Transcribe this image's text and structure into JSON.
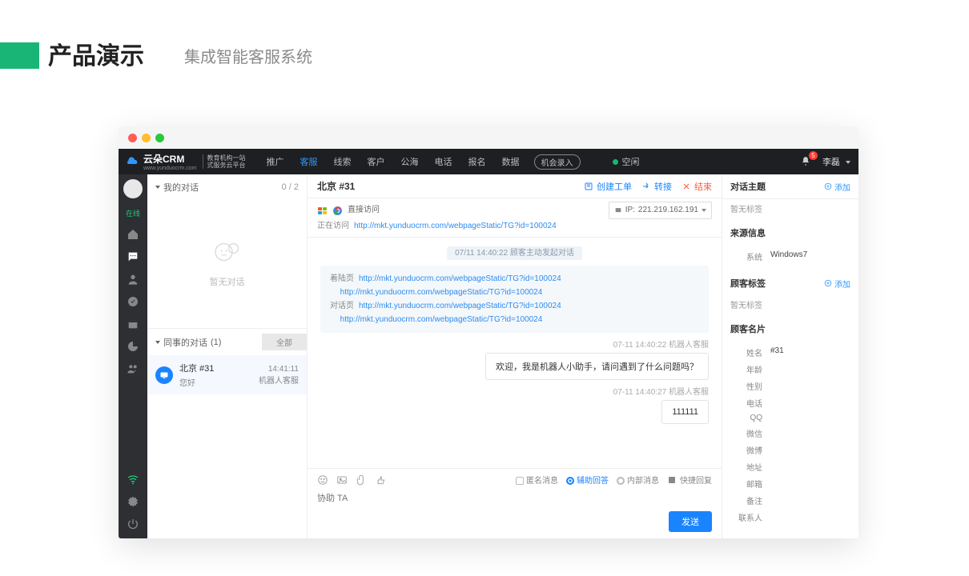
{
  "slide": {
    "title": "产品演示",
    "subtitle": "集成智能客服系统",
    "accent_color": "#19b576"
  },
  "window": {
    "traffic_colors": [
      "#ff5f56",
      "#ffbd2e",
      "#27c93f"
    ]
  },
  "nav": {
    "brand": "云朵CRM",
    "brand_sub_url": "www.yunduocrm.com",
    "tagline1": "教育机构一站",
    "tagline2": "式服务云平台",
    "tabs": [
      "推广",
      "客服",
      "线索",
      "客户",
      "公海",
      "电话",
      "报名",
      "数据"
    ],
    "active_tab_index": 1,
    "record_btn": "机会录入",
    "status_dot": "#19b576",
    "status_text": "空闲",
    "bell_count": "5",
    "user_name": "李磊"
  },
  "rail": {
    "status": "在线"
  },
  "conversations": {
    "mine_label": "我的对话",
    "mine_count": "0 / 2",
    "empty_text": "暂无对话",
    "colleague_label": "同事的对话",
    "colleague_count": "(1)",
    "all_btn": "全部",
    "item": {
      "title": "北京 #31",
      "snippet": "您好",
      "time": "14:41:11",
      "agent": "机器人客服"
    }
  },
  "chat": {
    "title": "北京 #31",
    "actions": {
      "order": "创建工单",
      "transfer": "转接",
      "end": "结束"
    },
    "direct_visit": "直接访问",
    "visiting_label": "正在访问",
    "visiting_url": "http://mkt.yunduocrm.com/webpageStatic/TG?id=100024",
    "ip_label": "IP:",
    "ip_value": "221.219.162.191",
    "sys_banner": "07/11 14:40:22  顾客主动发起对话",
    "info_card": {
      "landing_label": "着陆页",
      "talk_label": "对话页",
      "url": "http://mkt.yunduocrm.com/webpageStatic/TG?id=100024"
    },
    "ts1": "07-11 14:40:22  机器人客服",
    "bubble1": "欢迎，我是机器人小助手，请问遇到了什么问题吗？",
    "ts2": "07-11 14:40:27  机器人客服",
    "bubble2": "111111",
    "toolbar": {
      "anon": "匿名消息",
      "assist": "辅助回答",
      "internal": "内部消息",
      "quick": "快捷回复"
    },
    "placeholder": "协助 TA",
    "send": "发送"
  },
  "right": {
    "topic_label": "对话主题",
    "add_label": "添加",
    "no_tag": "暂无标签",
    "source_label": "来源信息",
    "source_system_k": "系统",
    "source_system_v": "Windows7",
    "guest_tag_label": "顾客标签",
    "card_label": "顾客名片",
    "card": [
      {
        "k": "姓名",
        "v": "#31"
      },
      {
        "k": "年龄",
        "v": ""
      },
      {
        "k": "性别",
        "v": ""
      },
      {
        "k": "电话",
        "v": ""
      },
      {
        "k": "QQ",
        "v": ""
      },
      {
        "k": "微信",
        "v": ""
      },
      {
        "k": "微博",
        "v": ""
      },
      {
        "k": "地址",
        "v": ""
      },
      {
        "k": "邮箱",
        "v": ""
      },
      {
        "k": "备注",
        "v": ""
      },
      {
        "k": "联系人",
        "v": ""
      }
    ]
  }
}
